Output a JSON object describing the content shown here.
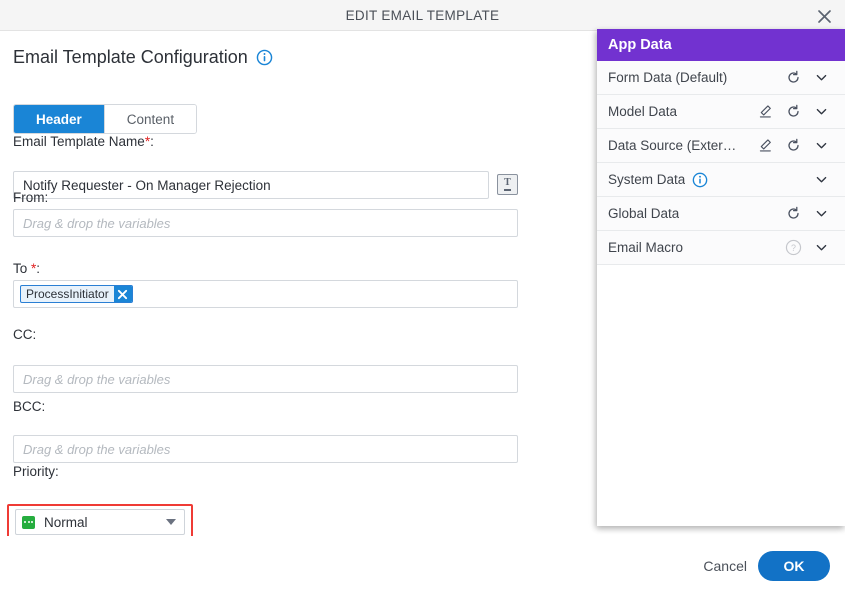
{
  "window": {
    "title": "EDIT EMAIL TEMPLATE",
    "close_label": "close-icon"
  },
  "page": {
    "title": "Email Template Configuration",
    "info_icon": "info-icon"
  },
  "tabs": [
    {
      "label": "Header",
      "active": true
    },
    {
      "label": "Content",
      "active": false
    }
  ],
  "fields": {
    "template_name": {
      "label": "Email Template Name",
      "required_mark": "*",
      "colon": ":",
      "value": "Notify Requester - On Manager Rejection",
      "text_button_glyph": "T"
    },
    "from": {
      "label": "From:",
      "value": "",
      "placeholder": "Drag & drop the variables"
    },
    "to": {
      "label": "To",
      "required_mark": "*",
      "colon": ":",
      "chips": [
        {
          "label": "ProcessInitiator",
          "remove_icon": "close-icon"
        }
      ]
    },
    "cc": {
      "label": "CC:",
      "value": "",
      "placeholder": "Drag & drop the variables"
    },
    "bcc": {
      "label": "BCC:",
      "value": "",
      "placeholder": "Drag & drop the variables"
    },
    "priority": {
      "label": "Priority:",
      "selected": "Normal",
      "icon": "priority-normal-icon",
      "highlight_color": "#ef3b35"
    }
  },
  "app_data": {
    "title": "App Data",
    "header_color": "#7232d0",
    "rows": [
      {
        "label": "Form Data (Default)",
        "has_edit": false,
        "has_refresh": true,
        "has_info": false,
        "has_help": false,
        "has_chevron": true
      },
      {
        "label": "Model Data",
        "has_edit": true,
        "has_refresh": true,
        "has_info": false,
        "has_help": false,
        "has_chevron": true
      },
      {
        "label": "Data Source (Exter…",
        "has_edit": true,
        "has_refresh": true,
        "has_info": false,
        "has_help": false,
        "has_chevron": true
      },
      {
        "label": "System Data",
        "has_edit": false,
        "has_refresh": false,
        "has_info": true,
        "has_help": false,
        "has_chevron": true
      },
      {
        "label": "Global Data",
        "has_edit": false,
        "has_refresh": true,
        "has_info": false,
        "has_help": false,
        "has_chevron": true
      },
      {
        "label": "Email Macro",
        "has_edit": false,
        "has_refresh": false,
        "has_info": false,
        "has_help": true,
        "has_chevron": true
      }
    ]
  },
  "footer": {
    "cancel_label": "Cancel",
    "ok_label": "OK",
    "ok_color": "#1272c6"
  }
}
